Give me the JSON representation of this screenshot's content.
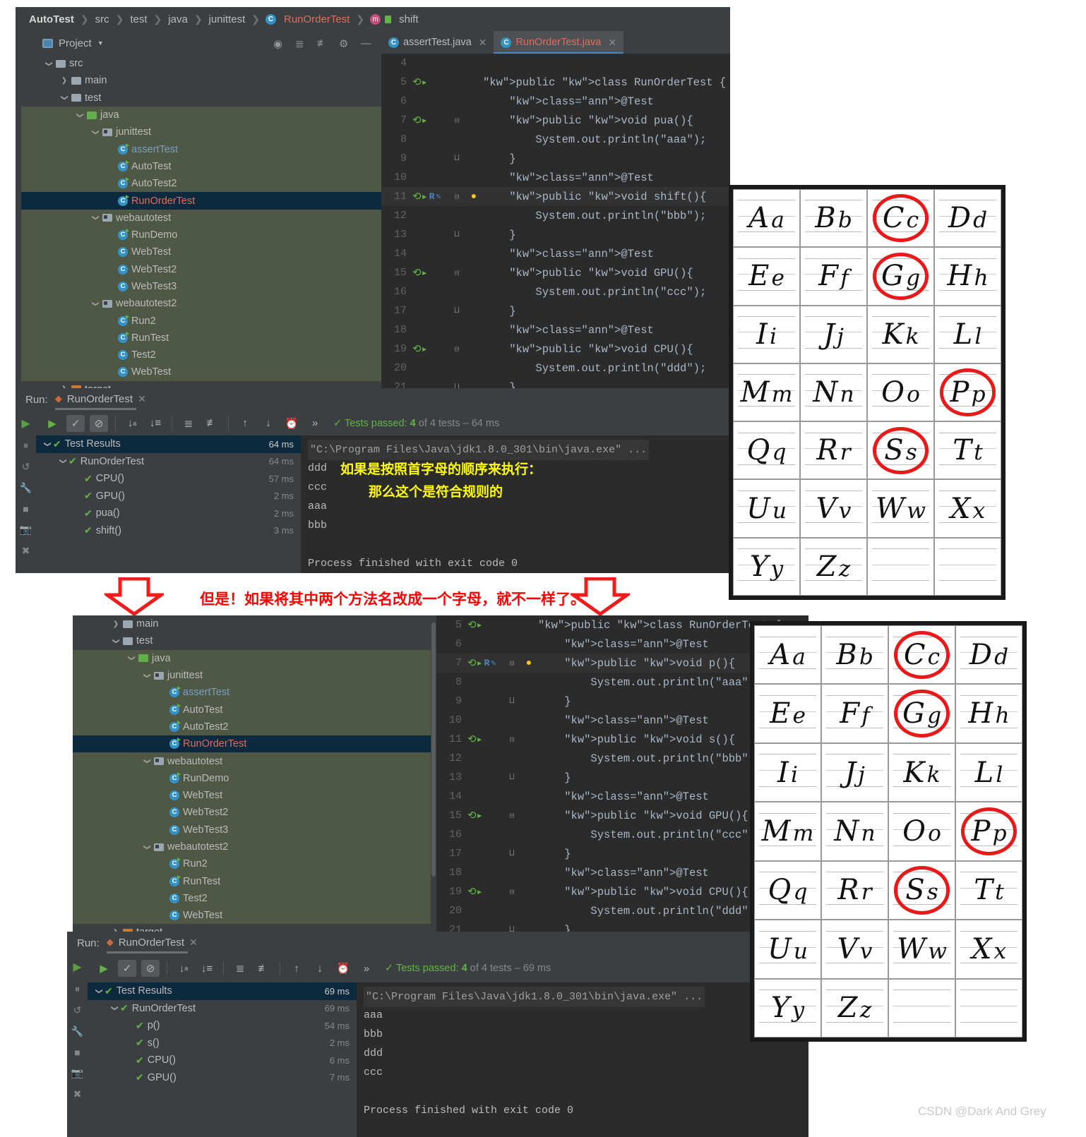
{
  "watermark": "CSDN @Dark And Grey",
  "annotations": {
    "yellow_line1": "如果是按照首字母的顺序来执行：",
    "yellow_line2": "那么这个是符合规则的",
    "red_middle": "但是！如果将其中两个方法名改成一个字母，就不一样了。"
  },
  "panel_top": {
    "breadcrumb": [
      "AutoTest",
      "src",
      "test",
      "java",
      "junittest",
      "RunOrderTest",
      "shift"
    ],
    "project": {
      "title": "Project",
      "tools": [
        "locate-icon",
        "expand-all-icon",
        "collapse-all-icon",
        "gear-icon",
        "minimize-icon"
      ],
      "tree": [
        {
          "label": "src",
          "indent": 1,
          "arrow": "v",
          "icon": "folder-grey",
          "state": "dark"
        },
        {
          "label": "main",
          "indent": 2,
          "arrow": ">",
          "icon": "folder-grey",
          "state": "dark"
        },
        {
          "label": "test",
          "indent": 2,
          "arrow": "v",
          "icon": "folder-grey",
          "state": "dark"
        },
        {
          "label": "java",
          "indent": 3,
          "arrow": "v",
          "icon": "folder-green",
          "state": "green"
        },
        {
          "label": "junittest",
          "indent": 4,
          "arrow": "v",
          "icon": "package",
          "state": "green"
        },
        {
          "label": "assertTest",
          "indent": 5,
          "arrow": "",
          "icon": "class-run",
          "state": "green",
          "color": "blue"
        },
        {
          "label": "AutoTest",
          "indent": 5,
          "arrow": "",
          "icon": "class-run",
          "state": "green"
        },
        {
          "label": "AutoTest2",
          "indent": 5,
          "arrow": "",
          "icon": "class-run",
          "state": "green"
        },
        {
          "label": "RunOrderTest",
          "indent": 5,
          "arrow": "",
          "icon": "class-run",
          "state": "sel",
          "color": "red"
        },
        {
          "label": "webautotest",
          "indent": 4,
          "arrow": "v",
          "icon": "package",
          "state": "green"
        },
        {
          "label": "RunDemo",
          "indent": 5,
          "arrow": "",
          "icon": "class-run",
          "state": "green"
        },
        {
          "label": "WebTest",
          "indent": 5,
          "arrow": "",
          "icon": "class",
          "state": "green"
        },
        {
          "label": "WebTest2",
          "indent": 5,
          "arrow": "",
          "icon": "class",
          "state": "green"
        },
        {
          "label": "WebTest3",
          "indent": 5,
          "arrow": "",
          "icon": "class",
          "state": "green"
        },
        {
          "label": "webautotest2",
          "indent": 4,
          "arrow": "v",
          "icon": "package",
          "state": "green"
        },
        {
          "label": "Run2",
          "indent": 5,
          "arrow": "",
          "icon": "class-run",
          "state": "green"
        },
        {
          "label": "RunTest",
          "indent": 5,
          "arrow": "",
          "icon": "class-run",
          "state": "green"
        },
        {
          "label": "Test2",
          "indent": 5,
          "arrow": "",
          "icon": "class",
          "state": "green"
        },
        {
          "label": "WebTest",
          "indent": 5,
          "arrow": "",
          "icon": "class",
          "state": "green"
        },
        {
          "label": "target",
          "indent": 2,
          "arrow": ">",
          "icon": "folder-orange",
          "state": "dark"
        }
      ]
    },
    "editor": {
      "tabs": [
        {
          "label": "assertTest.java",
          "active": false
        },
        {
          "label": "RunOrderTest.java",
          "active": true
        }
      ],
      "lines": [
        {
          "n": "4",
          "gutter": "",
          "fold": "",
          "bulb": false,
          "text": ""
        },
        {
          "n": "5",
          "gutter": "run",
          "fold": "",
          "bulb": false,
          "text": "public class RunOrderTest {"
        },
        {
          "n": "6",
          "gutter": "",
          "fold": "",
          "bulb": false,
          "text": "    @Test"
        },
        {
          "n": "7",
          "gutter": "run",
          "fold": "-",
          "bulb": false,
          "text": "    public void pua(){"
        },
        {
          "n": "8",
          "gutter": "",
          "fold": "",
          "bulb": false,
          "text": "        System.out.println(\"aaa\");"
        },
        {
          "n": "9",
          "gutter": "",
          "fold": "^",
          "bulb": false,
          "text": "    }"
        },
        {
          "n": "10",
          "gutter": "",
          "fold": "",
          "bulb": false,
          "text": "    @Test"
        },
        {
          "n": "11",
          "gutter": "runR",
          "fold": "-",
          "bulb": true,
          "text": "    public void shift(){",
          "highlight": true,
          "caret_token": "shift"
        },
        {
          "n": "12",
          "gutter": "",
          "fold": "",
          "bulb": false,
          "text": "        System.out.println(\"bbb\");"
        },
        {
          "n": "13",
          "gutter": "",
          "fold": "^",
          "bulb": false,
          "text": "    }"
        },
        {
          "n": "14",
          "gutter": "",
          "fold": "",
          "bulb": false,
          "text": "    @Test"
        },
        {
          "n": "15",
          "gutter": "run",
          "fold": "-",
          "bulb": false,
          "text": "    public void GPU(){"
        },
        {
          "n": "16",
          "gutter": "",
          "fold": "",
          "bulb": false,
          "text": "        System.out.println(\"ccc\");"
        },
        {
          "n": "17",
          "gutter": "",
          "fold": "^",
          "bulb": false,
          "text": "    }"
        },
        {
          "n": "18",
          "gutter": "",
          "fold": "",
          "bulb": false,
          "text": "    @Test"
        },
        {
          "n": "19",
          "gutter": "run",
          "fold": "-",
          "bulb": false,
          "text": "    public void CPU(){"
        },
        {
          "n": "20",
          "gutter": "",
          "fold": "",
          "bulb": false,
          "text": "        System.out.println(\"ddd\");"
        },
        {
          "n": "21",
          "gutter": "",
          "fold": "^",
          "bulb": false,
          "text": "    }"
        }
      ]
    },
    "run": {
      "label": "Run:",
      "config_name": "RunOrderTest",
      "toolbar_icons": [
        "rerun-icon",
        "show-passed-icon",
        "show-ignored-icon",
        "sort-alpha-icon",
        "sort-duration-icon",
        "expand-all-icon",
        "collapse-all-icon",
        "prev-icon",
        "next-icon",
        "history-icon",
        "more-icon"
      ],
      "status": {
        "prefix": "Tests passed:",
        "count": "4",
        "suffix": "of 4 tests – 64 ms"
      },
      "results": [
        {
          "label": "Test Results",
          "time": "64 ms",
          "indent": 0,
          "arrow": "v",
          "selected": true
        },
        {
          "label": "RunOrderTest",
          "time": "64 ms",
          "indent": 1,
          "arrow": "v",
          "selected": false
        },
        {
          "label": "CPU()",
          "time": "57 ms",
          "indent": 2,
          "arrow": "",
          "selected": false
        },
        {
          "label": "GPU()",
          "time": "2 ms",
          "indent": 2,
          "arrow": "",
          "selected": false
        },
        {
          "label": "pua()",
          "time": "2 ms",
          "indent": 2,
          "arrow": "",
          "selected": false
        },
        {
          "label": "shift()",
          "time": "3 ms",
          "indent": 2,
          "arrow": "",
          "selected": false
        }
      ],
      "console": {
        "command": "\"C:\\Program Files\\Java\\jdk1.8.0_301\\bin\\java.exe\" ...",
        "output": [
          "ddd",
          "ccc",
          "aaa",
          "bbb",
          "",
          "Process finished with exit code 0"
        ]
      }
    }
  },
  "panel_bottom": {
    "project": {
      "tree": [
        {
          "label": "main",
          "indent": 2,
          "arrow": ">",
          "icon": "folder-grey",
          "state": "dark"
        },
        {
          "label": "test",
          "indent": 2,
          "arrow": "v",
          "icon": "folder-grey",
          "state": "dark"
        },
        {
          "label": "java",
          "indent": 3,
          "arrow": "v",
          "icon": "folder-green",
          "state": "green"
        },
        {
          "label": "junittest",
          "indent": 4,
          "arrow": "v",
          "icon": "package",
          "state": "green"
        },
        {
          "label": "assertTest",
          "indent": 5,
          "arrow": "",
          "icon": "class-run",
          "state": "green",
          "color": "blue"
        },
        {
          "label": "AutoTest",
          "indent": 5,
          "arrow": "",
          "icon": "class-run",
          "state": "green"
        },
        {
          "label": "AutoTest2",
          "indent": 5,
          "arrow": "",
          "icon": "class-run",
          "state": "green"
        },
        {
          "label": "RunOrderTest",
          "indent": 5,
          "arrow": "",
          "icon": "class-run",
          "state": "sel",
          "color": "red"
        },
        {
          "label": "webautotest",
          "indent": 4,
          "arrow": "v",
          "icon": "package",
          "state": "green"
        },
        {
          "label": "RunDemo",
          "indent": 5,
          "arrow": "",
          "icon": "class-run",
          "state": "green"
        },
        {
          "label": "WebTest",
          "indent": 5,
          "arrow": "",
          "icon": "class",
          "state": "green"
        },
        {
          "label": "WebTest2",
          "indent": 5,
          "arrow": "",
          "icon": "class",
          "state": "green"
        },
        {
          "label": "WebTest3",
          "indent": 5,
          "arrow": "",
          "icon": "class",
          "state": "green"
        },
        {
          "label": "webautotest2",
          "indent": 4,
          "arrow": "v",
          "icon": "package",
          "state": "green"
        },
        {
          "label": "Run2",
          "indent": 5,
          "arrow": "",
          "icon": "class-run",
          "state": "green"
        },
        {
          "label": "RunTest",
          "indent": 5,
          "arrow": "",
          "icon": "class-run",
          "state": "green"
        },
        {
          "label": "Test2",
          "indent": 5,
          "arrow": "",
          "icon": "class",
          "state": "green"
        },
        {
          "label": "WebTest",
          "indent": 5,
          "arrow": "",
          "icon": "class",
          "state": "green"
        },
        {
          "label": "target",
          "indent": 2,
          "arrow": ">",
          "icon": "folder-orange",
          "state": "dark"
        }
      ]
    },
    "editor": {
      "lines": [
        {
          "n": "5",
          "gutter": "run",
          "fold": "",
          "bulb": false,
          "text": "public class RunOrderTest {"
        },
        {
          "n": "6",
          "gutter": "",
          "fold": "",
          "bulb": false,
          "text": "    @Test"
        },
        {
          "n": "7",
          "gutter": "runR",
          "fold": "-",
          "bulb": true,
          "text": "    public void p(){",
          "highlight": true,
          "caret_token": "p"
        },
        {
          "n": "8",
          "gutter": "",
          "fold": "",
          "bulb": false,
          "text": "        System.out.println(\"aaa\");"
        },
        {
          "n": "9",
          "gutter": "",
          "fold": "^",
          "bulb": false,
          "text": "    }"
        },
        {
          "n": "10",
          "gutter": "",
          "fold": "",
          "bulb": false,
          "text": "    @Test"
        },
        {
          "n": "11",
          "gutter": "run",
          "fold": "-",
          "bulb": false,
          "text": "    public void s(){"
        },
        {
          "n": "12",
          "gutter": "",
          "fold": "",
          "bulb": false,
          "text": "        System.out.println(\"bbb\");"
        },
        {
          "n": "13",
          "gutter": "",
          "fold": "^",
          "bulb": false,
          "text": "    }"
        },
        {
          "n": "14",
          "gutter": "",
          "fold": "",
          "bulb": false,
          "text": "    @Test"
        },
        {
          "n": "15",
          "gutter": "run",
          "fold": "-",
          "bulb": false,
          "text": "    public void GPU(){"
        },
        {
          "n": "16",
          "gutter": "",
          "fold": "",
          "bulb": false,
          "text": "        System.out.println(\"ccc\");"
        },
        {
          "n": "17",
          "gutter": "",
          "fold": "^",
          "bulb": false,
          "text": "    }"
        },
        {
          "n": "18",
          "gutter": "",
          "fold": "",
          "bulb": false,
          "text": "    @Test"
        },
        {
          "n": "19",
          "gutter": "run",
          "fold": "-",
          "bulb": false,
          "text": "    public void CPU(){"
        },
        {
          "n": "20",
          "gutter": "",
          "fold": "",
          "bulb": false,
          "text": "        System.out.println(\"ddd\");"
        },
        {
          "n": "21",
          "gutter": "",
          "fold": "^",
          "bulb": false,
          "text": "    }"
        }
      ]
    },
    "run": {
      "label": "Run:",
      "config_name": "RunOrderTest",
      "status": {
        "prefix": "Tests passed:",
        "count": "4",
        "suffix": "of 4 tests – 69 ms"
      },
      "results": [
        {
          "label": "Test Results",
          "time": "69 ms",
          "indent": 0,
          "arrow": "v",
          "selected": true
        },
        {
          "label": "RunOrderTest",
          "time": "69 ms",
          "indent": 1,
          "arrow": "v",
          "selected": false
        },
        {
          "label": "p()",
          "time": "54 ms",
          "indent": 2,
          "arrow": "",
          "selected": false
        },
        {
          "label": "s()",
          "time": "2 ms",
          "indent": 2,
          "arrow": "",
          "selected": false
        },
        {
          "label": "CPU()",
          "time": "6 ms",
          "indent": 2,
          "arrow": "",
          "selected": false
        },
        {
          "label": "GPU()",
          "time": "7 ms",
          "indent": 2,
          "arrow": "",
          "selected": false
        }
      ],
      "console": {
        "command": "\"C:\\Program Files\\Java\\jdk1.8.0_301\\bin\\java.exe\" ...",
        "output": [
          "aaa",
          "bbb",
          "ddd",
          "ccc",
          "",
          "Process finished with exit code 0"
        ]
      }
    }
  },
  "alphabet_chart": {
    "circled": [
      "C",
      "G",
      "P",
      "S"
    ],
    "cells": [
      {
        "upper": "A",
        "lower": "a"
      },
      {
        "upper": "B",
        "lower": "b"
      },
      {
        "upper": "C",
        "lower": "c"
      },
      {
        "upper": "D",
        "lower": "d"
      },
      {
        "upper": "E",
        "lower": "e"
      },
      {
        "upper": "F",
        "lower": "f"
      },
      {
        "upper": "G",
        "lower": "g"
      },
      {
        "upper": "H",
        "lower": "h"
      },
      {
        "upper": "I",
        "lower": "i"
      },
      {
        "upper": "J",
        "lower": "j"
      },
      {
        "upper": "K",
        "lower": "k"
      },
      {
        "upper": "L",
        "lower": "l"
      },
      {
        "upper": "M",
        "lower": "m"
      },
      {
        "upper": "N",
        "lower": "n"
      },
      {
        "upper": "O",
        "lower": "o"
      },
      {
        "upper": "P",
        "lower": "p"
      },
      {
        "upper": "Q",
        "lower": "q"
      },
      {
        "upper": "R",
        "lower": "r"
      },
      {
        "upper": "S",
        "lower": "s"
      },
      {
        "upper": "T",
        "lower": "t"
      },
      {
        "upper": "U",
        "lower": "u"
      },
      {
        "upper": "V",
        "lower": "v"
      },
      {
        "upper": "W",
        "lower": "w"
      },
      {
        "upper": "X",
        "lower": "x"
      },
      {
        "upper": "Y",
        "lower": "y"
      },
      {
        "upper": "Z",
        "lower": "z"
      },
      {
        "upper": "",
        "lower": ""
      },
      {
        "upper": "",
        "lower": ""
      }
    ]
  }
}
